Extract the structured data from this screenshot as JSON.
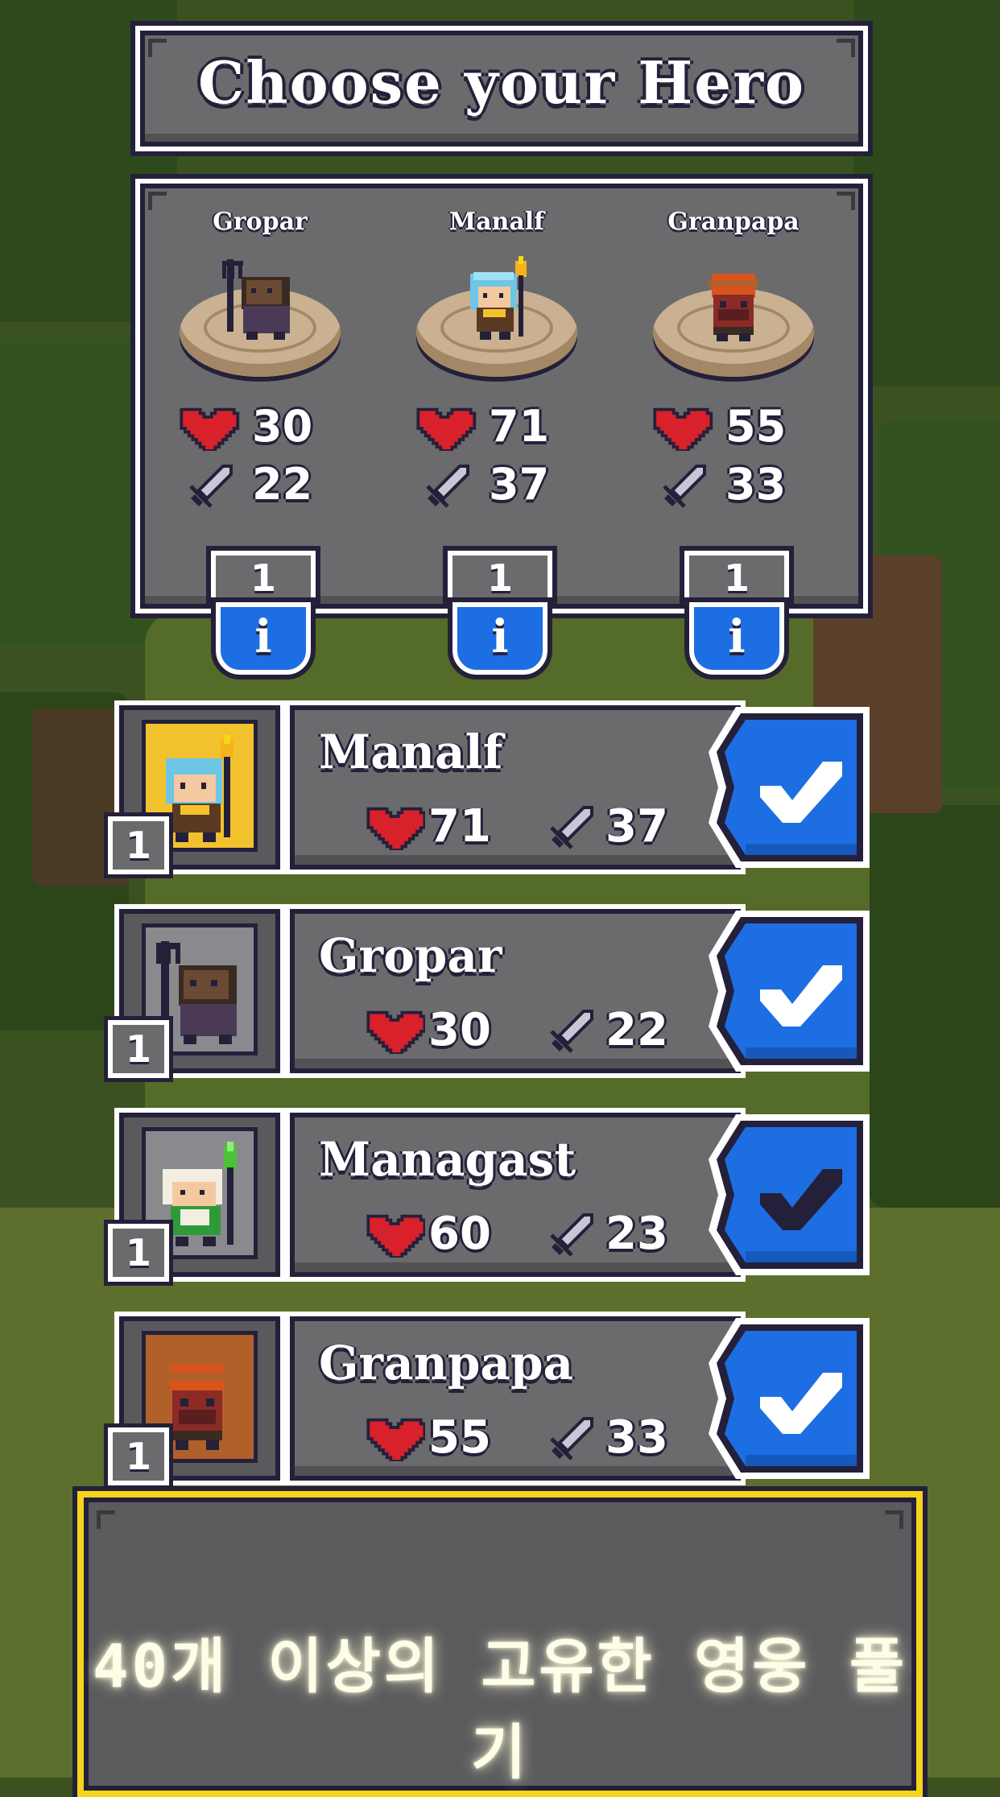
{
  "screen": {
    "title": "Choose your Hero"
  },
  "party": [
    {
      "name": "Gropar",
      "hp": "30",
      "atk": "22",
      "level": "1",
      "info_label": "i",
      "sprite": "gropar-sprite"
    },
    {
      "name": "Manalf",
      "hp": "71",
      "atk": "37",
      "level": "1",
      "info_label": "i",
      "sprite": "manalf-sprite"
    },
    {
      "name": "Granpapa",
      "hp": "55",
      "atk": "33",
      "level": "1",
      "info_label": "i",
      "sprite": "granpapa-sprite"
    }
  ],
  "roster": [
    {
      "name": "Manalf",
      "hp": "71",
      "atk": "37",
      "level": "1",
      "selected": true,
      "card_color": "#f2c12e",
      "sprite": "manalf-sprite"
    },
    {
      "name": "Gropar",
      "hp": "30",
      "atk": "22",
      "level": "1",
      "selected": true,
      "card_color": "#8a8a8e",
      "sprite": "gropar-sprite"
    },
    {
      "name": "Managast",
      "hp": "60",
      "atk": "23",
      "level": "1",
      "selected": false,
      "card_color": "#8a8a8e",
      "sprite": "managast-sprite"
    },
    {
      "name": "Granpapa",
      "hp": "55",
      "atk": "33",
      "level": "1",
      "selected": true,
      "card_color": "#b2602a",
      "sprite": "granpapa-sprite"
    }
  ],
  "banner": {
    "text": "40개 이상의 고유한 영웅 풀기"
  },
  "colors": {
    "panel": "#6b6b6d",
    "outline": "#24203a",
    "accent_blue": "#1d6ee3",
    "banner_border": "#f5d41b",
    "heart": "#d8212b"
  },
  "icons": [
    "heart-icon",
    "sword-icon",
    "info-icon",
    "checkmark-icon"
  ]
}
